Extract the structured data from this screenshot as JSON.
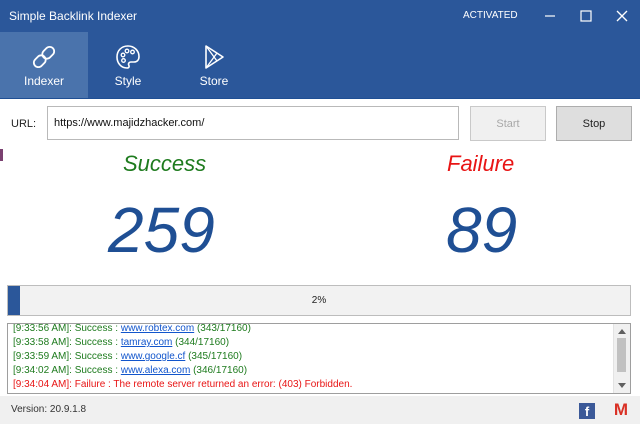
{
  "window": {
    "title": "Simple Backlink Indexer",
    "status": "ACTIVATED",
    "controls": [
      "minimize-icon",
      "maximize-icon",
      "close-icon"
    ]
  },
  "nav": {
    "items": [
      {
        "label": "Indexer",
        "icon": "link-icon",
        "active": true
      },
      {
        "label": "Style",
        "icon": "palette-icon",
        "active": false
      },
      {
        "label": "Store",
        "icon": "play-store-icon",
        "active": false
      }
    ]
  },
  "url": {
    "label": "URL:",
    "value": "https://www.majidzhacker.com/"
  },
  "buttons": {
    "start": "Start",
    "stop": "Stop"
  },
  "stats": {
    "success_label": "Success",
    "success_count": "259",
    "failure_label": "Failure",
    "failure_count": "89"
  },
  "progress": {
    "percent": 2,
    "label": "2%"
  },
  "log": {
    "entries": [
      {
        "prefix": "[9:33:56 AM]: Success : ",
        "link": "www.robtex.com",
        "suffix": " (343/17160)",
        "type": "success"
      },
      {
        "prefix": "[9:33:58 AM]: Success : ",
        "link": "tamray.com",
        "suffix": " (344/17160)",
        "type": "success"
      },
      {
        "prefix": "[9:33:59 AM]: Success : ",
        "link": "www.google.cf",
        "suffix": " (345/17160)",
        "type": "success"
      },
      {
        "prefix": "[9:34:02 AM]: Success : ",
        "link": "www.alexa.com",
        "suffix": " (346/17160)",
        "type": "success"
      },
      {
        "prefix": "[9:34:04 AM]: Failure : The remote server returned an error: (403) Forbidden.",
        "link": "",
        "suffix": "",
        "type": "failure"
      }
    ]
  },
  "footer": {
    "version": "Version: 20.9.1.8",
    "social": [
      "facebook-icon",
      "gmail-icon"
    ]
  },
  "colors": {
    "accent": "#2b579a",
    "success": "#1e7b1e",
    "failure": "#e81414",
    "counter": "#1f4f94"
  }
}
